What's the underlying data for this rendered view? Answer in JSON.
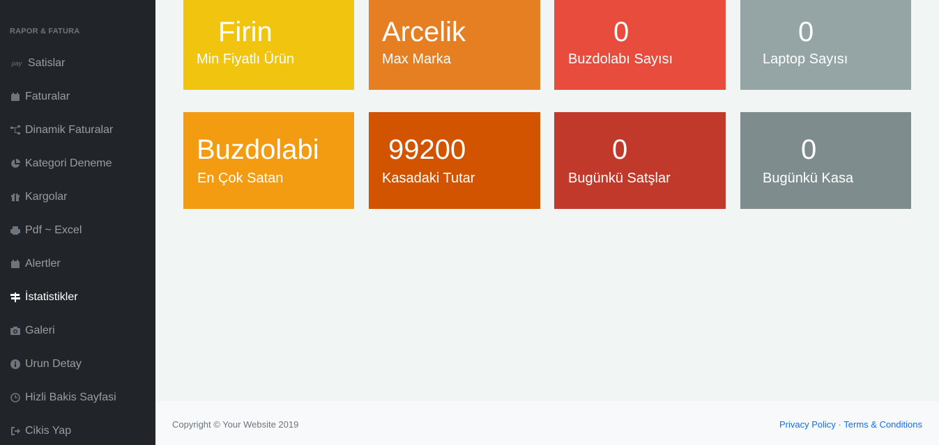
{
  "sidebar": {
    "heading": "RAPOR & FATURA",
    "items": [
      {
        "label": "Satislar",
        "icon": "amazon-pay-icon",
        "icon_text": "pay"
      },
      {
        "label": "Faturalar",
        "icon": "calendar-icon"
      },
      {
        "label": "Dinamik Faturalar",
        "icon": "sitemap-icon"
      },
      {
        "label": "Kategori Deneme",
        "icon": "pie-chart-icon"
      },
      {
        "label": "Kargolar",
        "icon": "gift-icon"
      },
      {
        "label": "Pdf ~ Excel",
        "icon": "print-icon"
      },
      {
        "label": "Alertler",
        "icon": "calendar-icon"
      },
      {
        "label": "İstatistikler",
        "icon": "signs-icon",
        "active": true
      },
      {
        "label": "Galeri",
        "icon": "camera-icon"
      },
      {
        "label": "Urun Detay",
        "icon": "info-circle-icon"
      },
      {
        "label": "Hizli Bakis Sayfasi",
        "icon": "clock-icon"
      },
      {
        "label": "Cikis Yap",
        "icon": "sign-out-icon"
      }
    ]
  },
  "stats": {
    "row1": [
      {
        "value": "Firin",
        "label": "Min Fiyatlı Ürün",
        "color": "#f1c40f"
      },
      {
        "value": "Arcelik",
        "label": "Max Marka",
        "color": "#e67e22"
      },
      {
        "value": "0",
        "label": "Buzdolabı Sayısı",
        "color": "#e74c3c"
      },
      {
        "value": "0",
        "label": "Laptop Sayısı",
        "color": "#95a5a6"
      }
    ],
    "row2": [
      {
        "value": "Buzdolabi",
        "label": "En Çok Satan",
        "color": "#f39c12"
      },
      {
        "value": "99200",
        "label": "Kasadaki Tutar",
        "color": "#d35400"
      },
      {
        "value": "0",
        "label": "Bugünkü Satşlar",
        "color": "#c0392b"
      },
      {
        "value": "0",
        "label": "Bugünkü Kasa",
        "color": "#7f8c8d"
      }
    ]
  },
  "footer": {
    "copyright": "Copyright © Your Website 2019",
    "privacy": "Privacy Policy",
    "separator": "·",
    "terms": "Terms & Conditions"
  }
}
